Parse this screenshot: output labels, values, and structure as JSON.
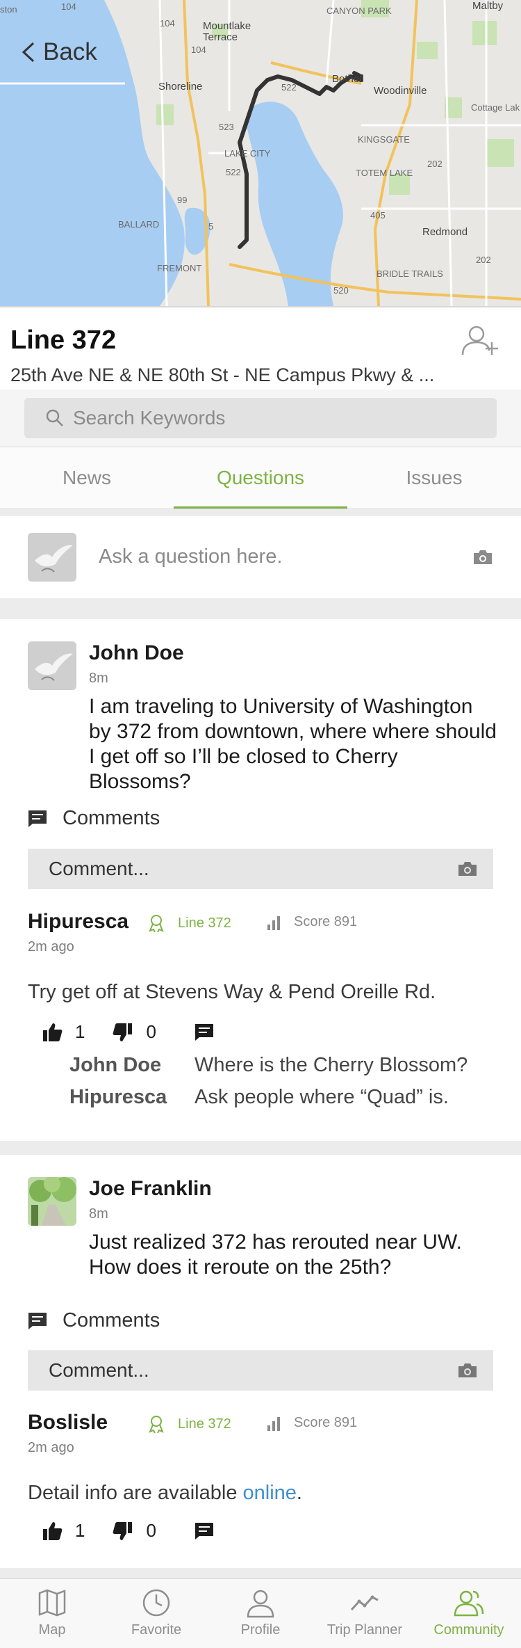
{
  "map": {
    "back_label": "Back",
    "labels": {
      "mountlake_terrace": "Mountlake\nTerrace",
      "shoreline": "Shoreline",
      "woodinville": "Woodinville",
      "cottage_lake": "Cottage Lak",
      "kingsgate": "KINGSGATE",
      "totem_lake": "TOTEM LAKE",
      "ballard": "BALLARD",
      "redmond": "Redmond",
      "fremont": "FREMONT",
      "bridle_trails": "BRIDLE TRAILS",
      "lake_city": "LAKE CITY",
      "canyon_park": "CANYON PARK",
      "bothell": "Bothell",
      "maltby": "Maltby",
      "edmonds": "ston",
      "r104": "104",
      "r522": "522",
      "r523": "523",
      "r99": "99",
      "r5": "5",
      "r405": "405",
      "r202": "202",
      "r520": "520"
    }
  },
  "header": {
    "title": "Line 372",
    "subtitle": "25th Ave NE & NE 80th St - NE Campus Pkwy & ..."
  },
  "search": {
    "placeholder": "Search Keywords"
  },
  "tabs": [
    {
      "label": "News"
    },
    {
      "label": "Questions"
    },
    {
      "label": "Issues"
    }
  ],
  "ask": {
    "placeholder": "Ask a question here."
  },
  "questions": [
    {
      "author": "John Doe",
      "time": "8m",
      "body": "I am traveling to University of Washington by 372 from downtown, where where should I get off so I’ll be closed to Cherry Blossoms?",
      "comments_label": "Comments",
      "comment_placeholder": "Comment...",
      "answer": {
        "author": "Hipuresca",
        "line_badge": "Line 372",
        "score": "Score 891",
        "time": "2m ago",
        "body": "Try get off at Stevens Way & Pend Oreille Rd.",
        "likes": "1",
        "dislikes": "0"
      },
      "replies": [
        {
          "name": "John Doe",
          "text": "Where is the Cherry Blossom?"
        },
        {
          "name": "Hipuresca",
          "text": "Ask people where “Quad” is."
        }
      ]
    },
    {
      "author": "Joe Franklin",
      "time": "8m",
      "body": "Just realized 372 has rerouted near UW. How does it reroute on the 25th?",
      "comments_label": "Comments",
      "comment_placeholder": "Comment...",
      "answer": {
        "author": "Boslisle",
        "line_badge": "Line 372",
        "score": "Score 891",
        "time": "2m ago",
        "body_prefix": "Detail info are available ",
        "body_link": "online",
        "body_suffix": ".",
        "likes": "1",
        "dislikes": "0"
      }
    }
  ],
  "nav": [
    {
      "label": "Map",
      "icon": "map-icon"
    },
    {
      "label": "Favorite",
      "icon": "clock-icon"
    },
    {
      "label": "Profile",
      "icon": "person-icon"
    },
    {
      "label": "Trip Planner",
      "icon": "trend-icon"
    },
    {
      "label": "Community",
      "icon": "community-icon",
      "active": true
    }
  ],
  "colors": {
    "accent": "#7cb342",
    "link": "#3d8fd1",
    "water": "#a7cdf2",
    "route": "#333333"
  }
}
